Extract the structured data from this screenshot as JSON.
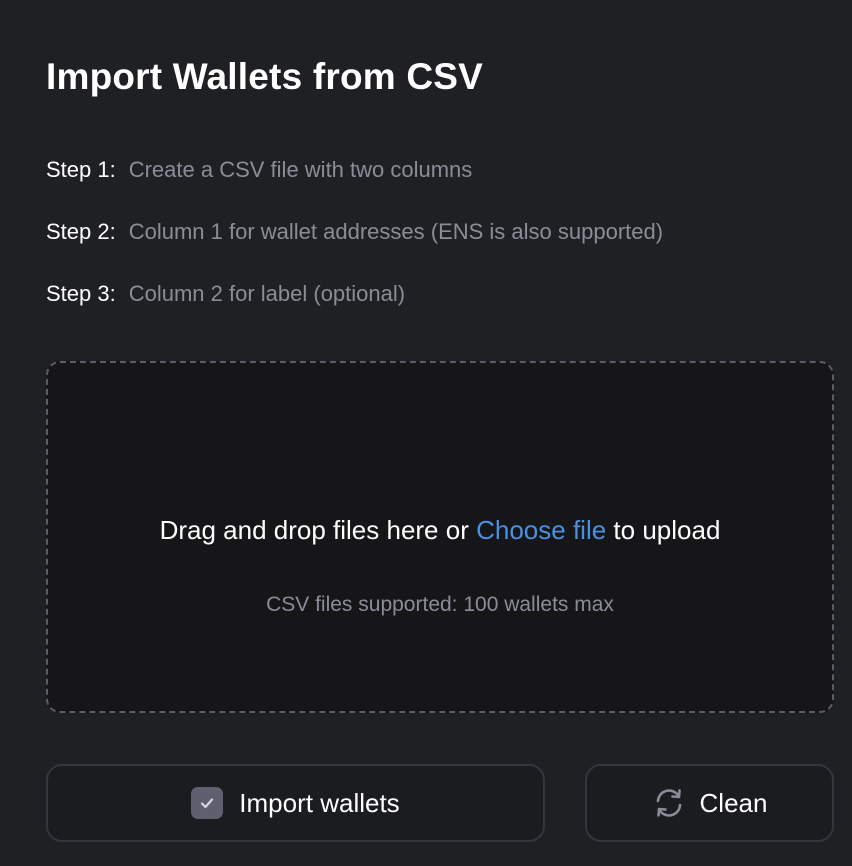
{
  "title": "Import Wallets from CSV",
  "steps": [
    {
      "label": "Step 1:",
      "text": "Create a CSV file with two columns"
    },
    {
      "label": "Step 2:",
      "text": "Column 1 for wallet addresses (ENS is also supported)"
    },
    {
      "label": "Step 3:",
      "text": "Column 2 for label (optional)"
    }
  ],
  "dropzone": {
    "prefix": "Drag and drop files here or",
    "link": "Choose file",
    "suffix": "to upload",
    "subtitle": "CSV files supported: 100 wallets max"
  },
  "buttons": {
    "import_label": "Import wallets",
    "import_icon": "checkbox-checked-icon",
    "clean_label": "Clean",
    "clean_icon": "refresh-icon"
  },
  "colors": {
    "background": "#1f2024",
    "dropzone_bg": "#161618",
    "link": "#4a90e2",
    "muted_text": "#8a8d98"
  }
}
